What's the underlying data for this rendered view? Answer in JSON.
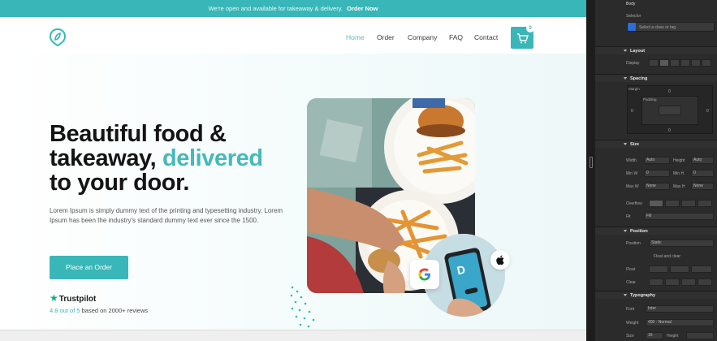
{
  "announcement": {
    "text": "We're open and available for takeaway & delivery.",
    "link": "Order Now"
  },
  "nav": {
    "items": [
      "Home",
      "Order",
      "Company",
      "FAQ",
      "Contact"
    ],
    "active": "Home",
    "cart_count": "0",
    "cart_icon": "cart-icon",
    "logo_icon": "leaf-pin-logo"
  },
  "hero": {
    "title_line1": "Beautiful food &",
    "title_line2a": "takeaway, ",
    "title_line2b": "delivered",
    "title_line3": "to your door.",
    "description": "Lorem Ipsum is simply dummy text of the printing and typesetting industry. Lorem Ipsum has been the industry's standard dummy text ever since the 1500.",
    "cta": "Place an Order"
  },
  "trust": {
    "brand": "Trustpilot",
    "rating_prefix": "4.8 out of 5",
    "rating_suffix": " based on 2000+ reviews"
  },
  "badges": {
    "google": "google-icon",
    "apple": "apple-icon"
  },
  "panel": {
    "header_item": "Body",
    "selector_label": "Selector",
    "selector_value": "Select a class or tag",
    "layout": "Layout",
    "display": "Display",
    "spacing": "Spacing",
    "margin": "Margin",
    "padding": "Padding",
    "size": "Size",
    "width": "Width",
    "height": "Height",
    "auto": "Auto",
    "min_w": "Min W",
    "min_h": "Min H",
    "max_w": "Max W",
    "max_h": "Max H",
    "overflow": "Overflow",
    "fit": "Fit",
    "fill": "Fill",
    "position": "Position",
    "position_label": "Position",
    "position_value": "Static",
    "float": "Float",
    "clear": "Clear",
    "float_clear": "Float and clear",
    "typography": "Typography",
    "font": "Font",
    "font_value": "Inter",
    "weight": "Weight",
    "weight_value": "400 - Normal",
    "size_label": "Size",
    "size_value": "16",
    "height_label": "Height",
    "none": "None",
    "zero": "0",
    "px": "PX",
    "dash": "—"
  },
  "colors": {
    "brand": "#39b6b8",
    "accent_text": "#45b9bb",
    "heading": "#141414",
    "trustpilot": "#00b67a",
    "panel_bg": "#2b2b2b"
  }
}
